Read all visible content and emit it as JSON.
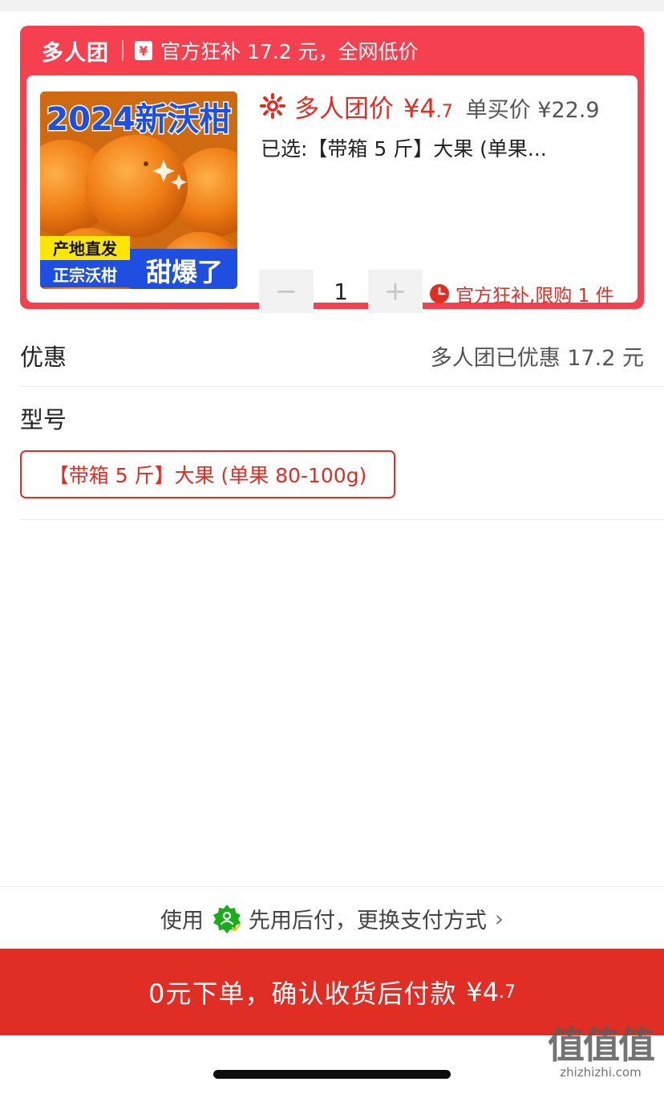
{
  "group_card": {
    "brand": "多人团",
    "subsidy_icon": "¥",
    "subsidy_text": "官方狂补 17.2 元，全网低价",
    "image": {
      "title": "2024新沃柑",
      "tag_top": "产地直发",
      "tag_bottom": "正宗沃柑",
      "tag_big": "甜爆了"
    },
    "group_price_label": "多人团价",
    "group_price": "¥4",
    "group_price_decimal": ".7",
    "solo_price": "单买价 ¥22.9",
    "selected_text": "已选:【带箱 5 斤】大果 (单果...",
    "quantity": "1",
    "minus_label": "−",
    "plus_label": "+",
    "limit_text": "官方狂补,限购 1 件"
  },
  "discount": {
    "label": "优惠",
    "value": "多人团已优惠 17.2 元"
  },
  "model": {
    "label": "型号",
    "options": [
      "【带箱 5 斤】大果 (单果 80-100g)"
    ],
    "selected_index": 0
  },
  "payment": {
    "prefix": "使用",
    "text": "先用后付，更换支付方式",
    "chevron": "›"
  },
  "order_button": {
    "text": "0元下单，确认收货后付款",
    "price": "¥4",
    "price_decimal": ".7"
  },
  "watermark": {
    "big": "值值值",
    "small": "zhizhizhi.com"
  },
  "colors": {
    "card_red": "#f5414f",
    "accent_red": "#e02e24",
    "pay_badge_green": "#1aad19"
  },
  "icons": {
    "subsidy": "yuan-coin-icon",
    "group_price": "burst-icon",
    "limit": "clock-icon",
    "payment": "credit-badge-icon"
  }
}
